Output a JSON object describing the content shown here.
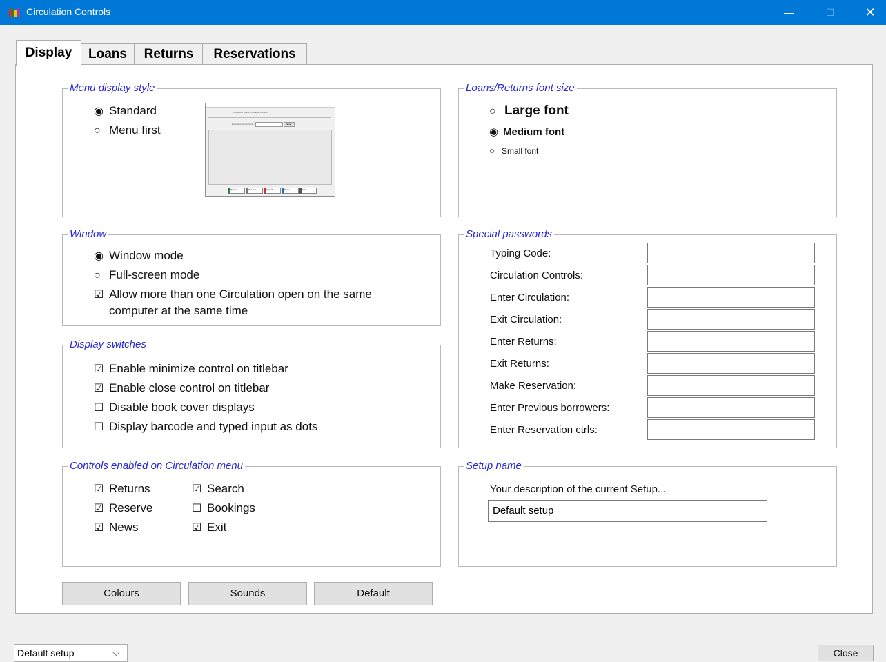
{
  "window": {
    "title": "Circulation Controls",
    "min_glyph": "—",
    "max_glyph": "☐",
    "close_glyph": "✕"
  },
  "tabs": [
    "Display",
    "Loans",
    "Returns",
    "Reservations"
  ],
  "menu_display_style": {
    "legend": "Menu display style",
    "options": [
      {
        "label": "Standard",
        "selected": true
      },
      {
        "label": "Menu first",
        "selected": false
      }
    ],
    "preview": {
      "header_text": "Circulation Loans    Circulation Returns",
      "field_label": "Enter borrower barcode >>",
      "button": "Enter",
      "footer_buttons": [
        "Returns",
        "Reserve",
        "Search",
        "News",
        "Exit"
      ]
    }
  },
  "font_size": {
    "legend": "Loans/Returns font size",
    "options": [
      {
        "label": "Large font",
        "selected": false
      },
      {
        "label": "Medium font",
        "selected": true
      },
      {
        "label": "Small font",
        "selected": false
      }
    ]
  },
  "window_group": {
    "legend": "Window",
    "options": [
      {
        "label": "Window mode",
        "selected": true
      },
      {
        "label": "Full-screen mode",
        "selected": false
      }
    ],
    "multi_open_line1": "Allow more than one Circulation open on the same",
    "multi_open_line2": "computer at the same time",
    "multi_open_checked": true
  },
  "display_switches": {
    "legend": "Display switches",
    "items": [
      {
        "label": "Enable minimize control on titlebar",
        "checked": true
      },
      {
        "label": "Enable close control on titlebar",
        "checked": true
      },
      {
        "label": "Disable book cover displays",
        "checked": false
      },
      {
        "label": "Display barcode and typed input as dots",
        "checked": false
      }
    ]
  },
  "special_passwords": {
    "legend": "Special passwords",
    "fields": [
      {
        "label": "Typing Code:",
        "value": ""
      },
      {
        "label": "Circulation Controls:",
        "value": ""
      },
      {
        "label": "Enter Circulation:",
        "value": ""
      },
      {
        "label": "Exit Circulation:",
        "value": ""
      },
      {
        "label": "Enter Returns:",
        "value": ""
      },
      {
        "label": "Exit Returns:",
        "value": ""
      },
      {
        "label": "Make Reservation:",
        "value": ""
      },
      {
        "label": "Enter Previous borrowers:",
        "value": ""
      },
      {
        "label": "Enter Reservation ctrls:",
        "value": ""
      }
    ]
  },
  "controls_enabled": {
    "legend": "Controls enabled on Circulation menu",
    "left": [
      {
        "label": "Returns",
        "checked": true
      },
      {
        "label": "Reserve",
        "checked": true
      },
      {
        "label": "News",
        "checked": true
      }
    ],
    "right": [
      {
        "label": "Search",
        "checked": true
      },
      {
        "label": "Bookings",
        "checked": false
      },
      {
        "label": "Exit",
        "checked": true
      }
    ]
  },
  "setup_name": {
    "legend": "Setup name",
    "description": "Your description of the current Setup...",
    "value": "Default setup"
  },
  "buttons": {
    "colours": "Colours",
    "sounds": "Sounds",
    "default": "Default"
  },
  "status": {
    "setup_select": "Default setup",
    "close": "Close"
  },
  "glyphs": {
    "radio_on": "◉",
    "radio_off": "○",
    "check_on": "☑",
    "check_off": "☐",
    "dropdown": "⌵"
  },
  "colors": {
    "titlebar": "#0078d7",
    "legend": "#2727d8"
  }
}
